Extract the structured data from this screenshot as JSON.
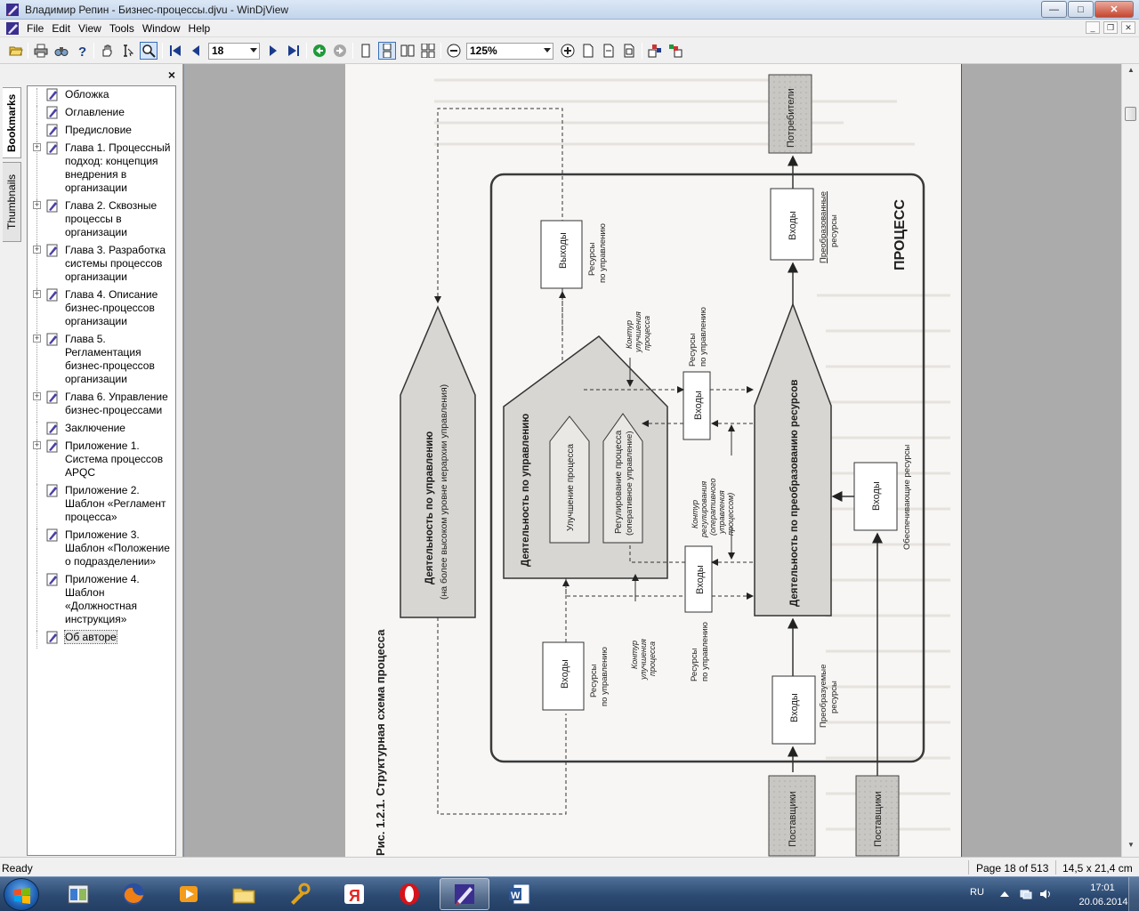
{
  "window": {
    "title": "Владимир Репин - Бизнес-процессы.djvu - WinDjView",
    "buttons": {
      "minimize": "—",
      "maximize": "□",
      "close": "✕"
    }
  },
  "menu": {
    "items": [
      "File",
      "Edit",
      "View",
      "Tools",
      "Window",
      "Help"
    ]
  },
  "toolbar": {
    "page_number": "18",
    "zoom": "125%"
  },
  "panel": {
    "tabs": [
      "Bookmarks",
      "Thumbnails"
    ],
    "close_label": "×",
    "bookmarks": [
      {
        "label": "Обложка",
        "expandable": false
      },
      {
        "label": "Оглавление",
        "expandable": false
      },
      {
        "label": "Предисловие",
        "expandable": false
      },
      {
        "label": "Глава 1. Процессный подход: концепция внедрения в организации",
        "expandable": true
      },
      {
        "label": "Глава 2. Сквозные процессы в организации",
        "expandable": true
      },
      {
        "label": "Глава 3. Разработка системы процессов организации",
        "expandable": true
      },
      {
        "label": "Глава 4. Описание бизнес-процессов организации",
        "expandable": true
      },
      {
        "label": "Глава 5. Регламентация бизнес-процессов организации",
        "expandable": true
      },
      {
        "label": "Глава 6. Управление бизнес-процессами",
        "expandable": true
      },
      {
        "label": "Заключение",
        "expandable": false
      },
      {
        "label": "Приложение 1. Система процессов APQC",
        "expandable": true
      },
      {
        "label": "Приложение 2. Шаблон «Регламент процесса»",
        "expandable": false
      },
      {
        "label": "Приложение 3. Шаблон «Положение о подразделении»",
        "expandable": false
      },
      {
        "label": "Приложение 4. Шаблон «Должностная инструкция»",
        "expandable": false
      },
      {
        "label": "Об авторе",
        "expandable": false
      }
    ]
  },
  "diagram": {
    "caption": "Рис. 1.2.1. Структурная схема процесса",
    "process_label": "ПРОЦЕСС",
    "top_management": "Деятельность по управлению",
    "top_management_sub": "(на более высоком уровне иерархии управления)",
    "management": "Деятельность по управлению",
    "improvement": "Улучшение процесса",
    "regulation": "Регулирование процесса",
    "regulation_sub": "(оперативное управление)",
    "transform": "Деятельность по преобразованию ресурсов",
    "outputs": "Выходы",
    "inputs": "Входы",
    "mgmt_resources": "Ресурсы",
    "mgmt_resources_2": "по управлению",
    "improvement_loop": "Контур",
    "improvement_loop_2": "улучшения",
    "improvement_loop_3": "процесса",
    "regulation_loop": [
      "Контур",
      "регулирования",
      "(оперативного",
      "управления",
      "процессом)"
    ],
    "transformed": "Преобразованные",
    "resources": "ресурсы",
    "to_transform": "Преобразуемые",
    "supporting": "Обеспечивающие ресурсы",
    "consumers": "Потребители",
    "suppliers": "Поставщики"
  },
  "status": {
    "ready": "Ready",
    "page": "Page 18 of 513",
    "size": "14,5 x 21,4 cm"
  },
  "taskbar": {
    "lang": "RU",
    "time": "17:01",
    "date": "20.06.2014"
  }
}
